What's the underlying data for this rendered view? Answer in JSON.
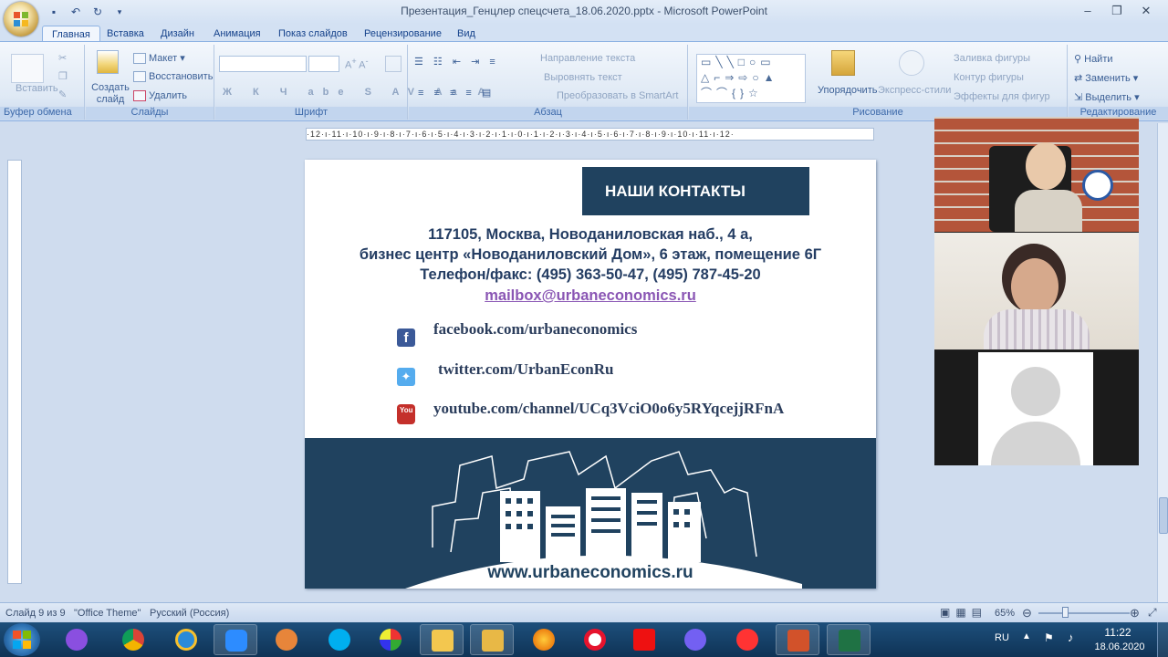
{
  "window": {
    "title": "Презентация_Генцлер спецсчета_18.06.2020.pptx - Microsoft PowerPoint"
  },
  "tabs": [
    "Главная",
    "Вставка",
    "Дизайн",
    "Анимация",
    "Показ слайдов",
    "Рецензирование",
    "Вид"
  ],
  "ribbon": {
    "clipboard": {
      "paste": "Вставить",
      "label": "Буфер обмена"
    },
    "slides": {
      "new_slide": "Создать слайд",
      "layout": "Макет",
      "reset": "Восстановить",
      "delete": "Удалить",
      "label": "Слайды"
    },
    "font": {
      "label": "Шрифт"
    },
    "paragraph": {
      "text_direction": "Направление текста",
      "align_text": "Выровнять текст",
      "smartart": "Преобразовать в SmartArt",
      "label": "Абзац"
    },
    "drawing": {
      "arrange": "Упорядочить",
      "quick_styles": "Экспресс-стили",
      "shape_fill": "Заливка фигуры",
      "shape_outline": "Контур фигуры",
      "shape_effects": "Эффекты для фигур",
      "label": "Рисование"
    },
    "editing": {
      "find": "Найти",
      "replace": "Заменить",
      "select": "Выделить",
      "label": "Редактирование"
    }
  },
  "ruler": {
    "h_ticks": "·12·ı·11·ı·10·ı·9·ı·8·ı·7·ı·6·ı·5·ı·4·ı·3·ı·2·ı·1·ı·0·ı·1·ı·2·ı·3·ı·4·ı·5·ı·6·ı·7·ı·8·ı·9·ı·10·ı·11·ı·12·"
  },
  "slide": {
    "header": "НАШИ КОНТАКТЫ",
    "address_line1": "117105, Москва, Новоданиловская наб., 4 а,",
    "address_line2": "бизнес центр «Новоданиловский Дом», 6 этаж, помещение 6Г",
    "phone": "Телефон/факс: (495) 363-50-47, (495) 787-45-20",
    "email": "mailbox@urbaneconomics.ru",
    "facebook": "facebook.com/urbaneconomics",
    "twitter": "twitter.com/UrbanEconRu",
    "youtube": "youtube.com/channel/UCq3VciO0o6y5RYqcejjRFnA",
    "website": "www.urbaneconomics.ru"
  },
  "statusbar": {
    "slide_info": "Слайд 9 из 9",
    "theme": "\"Office Theme\"",
    "language": "Русский (Россия)",
    "zoom": "65%"
  },
  "tray": {
    "lang": "RU",
    "time": "11:22",
    "date": "18.06.2020"
  },
  "colors": {
    "slide_dark": "#20425f",
    "email": "#8a56b4",
    "ribbon_text": "#15428b"
  }
}
